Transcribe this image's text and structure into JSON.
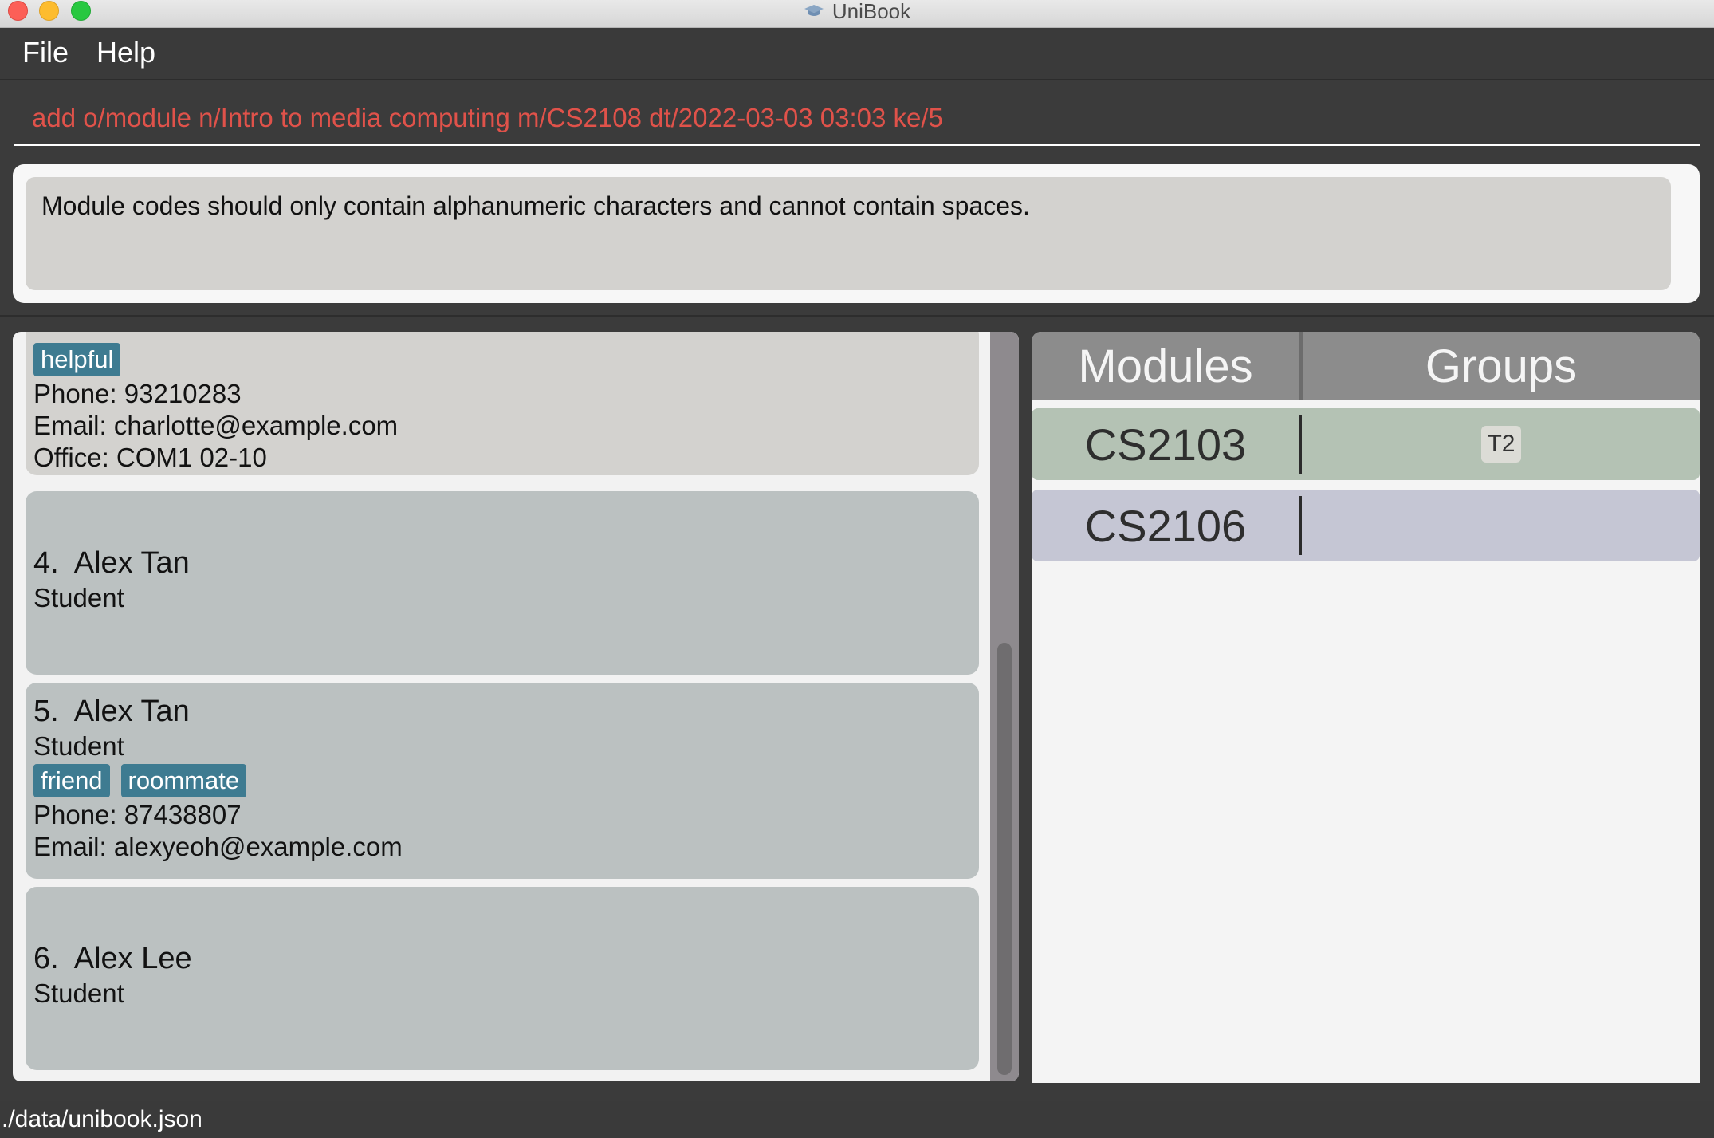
{
  "window": {
    "title": "UniBook"
  },
  "menu": {
    "items": [
      "File",
      "Help"
    ]
  },
  "command_box": {
    "value": "add o/module n/Intro to media computing m/CS2108 dt/2022-03-03 03:03 ke/5"
  },
  "result_display": {
    "message": "Module codes should only contain alphanumeric characters and cannot contain spaces."
  },
  "person_list": {
    "cards": [
      {
        "tags": [
          "helpful"
        ],
        "phone": "Phone: 93210283",
        "email": "Email: charlotte@example.com",
        "office": "Office: COM1 02-10"
      },
      {
        "index": "4.",
        "name": "Alex Tan",
        "role": "Student"
      },
      {
        "index": "5.",
        "name": "Alex Tan",
        "role": "Student",
        "tags": [
          "friend",
          "roommate"
        ],
        "phone": "Phone: 87438807",
        "email": "Email: alexyeoh@example.com"
      },
      {
        "index": "6.",
        "name": "Alex Lee",
        "role": "Student"
      }
    ]
  },
  "module_panel": {
    "headers": {
      "modules": "Modules",
      "groups": "Groups"
    },
    "rows": [
      {
        "code": "CS2103",
        "groups": [
          "T2"
        ],
        "color": "#b4c2b4"
      },
      {
        "code": "CS2106",
        "groups": [],
        "color": "#c5c6d4"
      }
    ]
  },
  "status_bar": {
    "path": "./data/unibook.json"
  },
  "colors": {
    "command_text": "#e0524a",
    "tag_bg": "#3e7b91",
    "card_bg": "#bbc1c1"
  }
}
